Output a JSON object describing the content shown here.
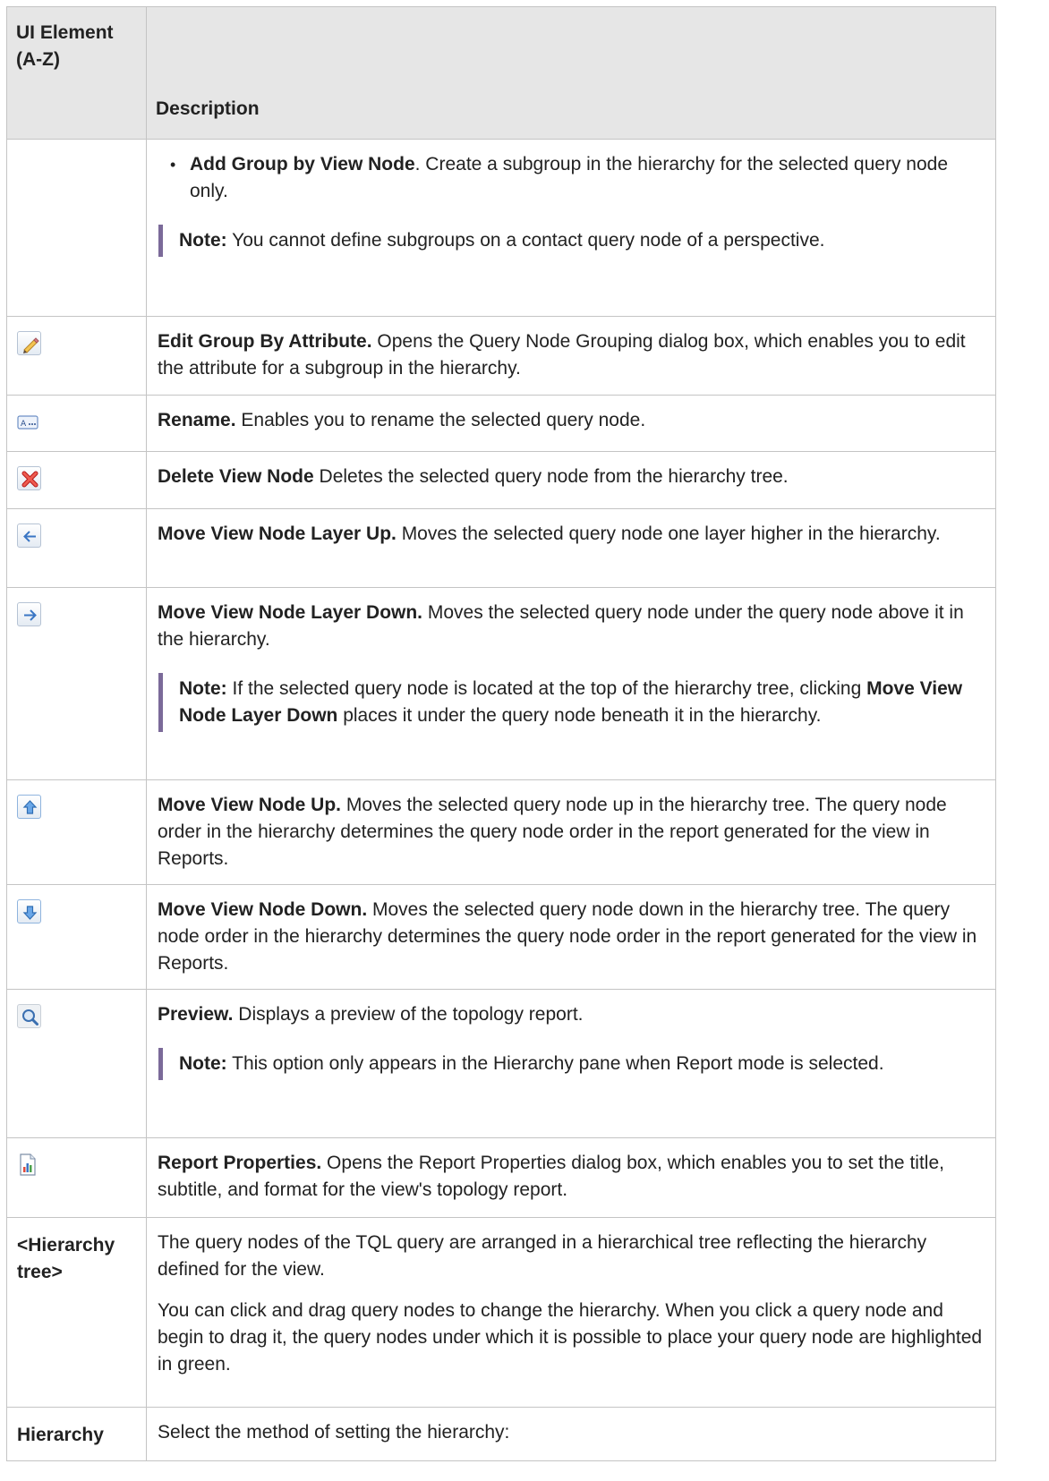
{
  "header": {
    "col1": "UI Element (A-Z)",
    "col2": "Description"
  },
  "rows": [
    {
      "bullet_title": "Add Group by View Node",
      "bullet_text": ". Create a subgroup in the hierarchy for the selected query node only.",
      "note_label": "Note:",
      "note_text": " You cannot define subgroups on a contact query node of a perspective."
    },
    {
      "icon": "pencil-icon",
      "title": "Edit Group By Attribute.",
      "text": " Opens the Query Node Grouping dialog box, which enables you to edit the attribute for a subgroup in the hierarchy."
    },
    {
      "icon": "rename-icon",
      "title": "Rename.",
      "text": " Enables you to rename the selected query node."
    },
    {
      "icon": "delete-icon",
      "title": "Delete View Node",
      "text": " Deletes the selected query node from the hierarchy tree."
    },
    {
      "icon": "arrow-left-icon",
      "title": "Move View Node Layer Up.",
      "text": " Moves the selected query node one layer higher in the hierarchy."
    },
    {
      "icon": "arrow-right-icon",
      "title": "Move View Node Layer Down.",
      "text": " Moves the selected query node under the query node above it in the hierarchy.",
      "note_label": "Note:",
      "note_text_1": " If the selected query node is located at the top of the hierarchy tree, clicking ",
      "note_bold": "Move View Node Layer Down",
      "note_text_2": " places it under the query node beneath it in the hierarchy."
    },
    {
      "icon": "arrow-up-icon",
      "title": "Move View Node Up.",
      "text": " Moves the selected query node up in the hierarchy tree. The query node order in the hierarchy determines the query node order in the report generated for the view in Reports."
    },
    {
      "icon": "arrow-down-icon",
      "title": "Move View Node Down.",
      "text": " Moves the selected query node down in the hierarchy tree. The query node order in the hierarchy determines the query node order in the report generated for the view in Reports."
    },
    {
      "icon": "magnifier-icon",
      "title": "Preview.",
      "text": " Displays a preview of the topology report.",
      "note_label": "Note:",
      "note_text": " This option only appears in the Hierarchy pane when Report mode is selected."
    },
    {
      "icon": "report-icon",
      "title": "Report Properties.",
      "text": " Opens the Report Properties dialog box, which enables you to set the title, subtitle, and format for the view's topology report."
    },
    {
      "element": "<Hierarchy tree>",
      "text_1": "The query nodes of the TQL query are arranged in a hierarchical tree reflecting the hierarchy defined for the view.",
      "text_2": "You can click and drag query nodes to change the hierarchy. When you click a query node and begin to drag it, the query nodes under which it is possible to place your query node are highlighted in green."
    },
    {
      "element": "Hierarchy",
      "text_1": "Select the method of setting the hierarchy:"
    }
  ]
}
